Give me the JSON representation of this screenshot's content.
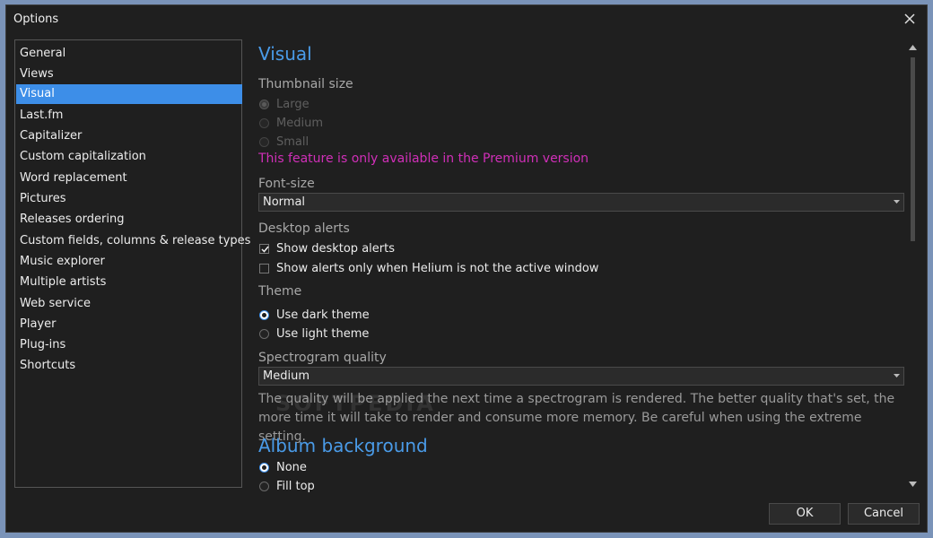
{
  "window": {
    "title": "Options"
  },
  "sidebar": {
    "items": [
      {
        "label": "General"
      },
      {
        "label": "Views"
      },
      {
        "label": "Visual"
      },
      {
        "label": "Last.fm"
      },
      {
        "label": "Capitalizer"
      },
      {
        "label": "Custom capitalization"
      },
      {
        "label": "Word replacement"
      },
      {
        "label": "Pictures"
      },
      {
        "label": "Releases ordering"
      },
      {
        "label": "Custom fields, columns & release types"
      },
      {
        "label": "Music explorer"
      },
      {
        "label": "Multiple artists"
      },
      {
        "label": "Web service"
      },
      {
        "label": "Player"
      },
      {
        "label": "Plug-ins"
      },
      {
        "label": "Shortcuts"
      }
    ],
    "selected": "Visual"
  },
  "content": {
    "heading": "Visual",
    "thumbnail": {
      "title": "Thumbnail size",
      "options": [
        "Large",
        "Medium",
        "Small"
      ],
      "selected": "Large",
      "premium_notice": "This feature is only available in the Premium version"
    },
    "font_size": {
      "title": "Font-size",
      "value": "Normal"
    },
    "desktop_alerts": {
      "title": "Desktop alerts",
      "show_alerts": {
        "label": "Show desktop alerts",
        "checked": true
      },
      "inactive_only": {
        "label": "Show alerts only when Helium is not the active window",
        "checked": false
      }
    },
    "theme": {
      "title": "Theme",
      "options": [
        "Use dark theme",
        "Use light theme"
      ],
      "selected": "Use dark theme"
    },
    "spectrogram": {
      "title": "Spectrogram quality",
      "value": "Medium",
      "description": "The quality will be applied the next time a spectrogram is rendered. The better quality that's set, the more time it will take to render and consume more memory. Be careful when using the extreme setting."
    },
    "album_background": {
      "heading": "Album background",
      "options": [
        "None",
        "Fill top"
      ],
      "selected": "None"
    }
  },
  "footer": {
    "ok_label": "OK",
    "cancel_label": "Cancel"
  },
  "watermark": "SOFTPEDIA",
  "colors": {
    "accent": "#3d8ee8",
    "heading": "#4a9be8",
    "premium": "#d02fb8",
    "background": "#1f1f1f"
  },
  "icons": {
    "close": "close-icon",
    "dropdown": "chevron-down-icon",
    "check": "check-icon"
  }
}
